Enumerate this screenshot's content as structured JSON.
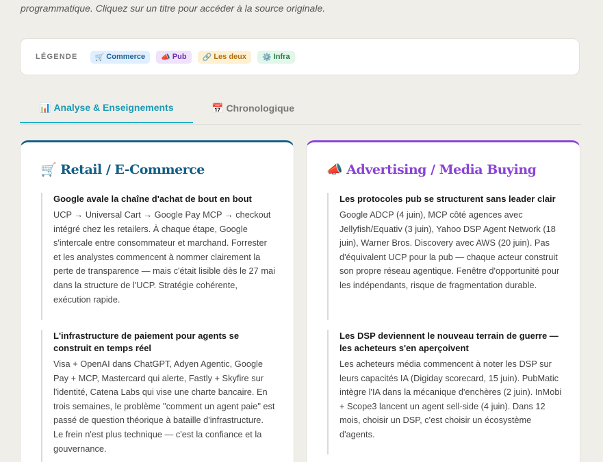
{
  "intro": {
    "text": "programmatique. Cliquez sur un titre pour accéder à la source originale."
  },
  "legend": {
    "title": "LÉGENDE",
    "badges": [
      {
        "icon": "🛒",
        "label": "Commerce",
        "color": "#1d5e92"
      },
      {
        "icon": "📣",
        "label": "Pub",
        "color": "#6b2fb3"
      },
      {
        "icon": "🔗",
        "label": "Les deux",
        "color": "#b0700e"
      },
      {
        "icon": "⚙️",
        "label": "Infra",
        "color": "#1f7a45"
      }
    ]
  },
  "tabs": [
    {
      "icon": "📊",
      "label": "Analyse & Enseignements",
      "active": true,
      "color": "#1b9bb3"
    },
    {
      "icon": "📅",
      "label": "Chronologique",
      "active": false
    }
  ],
  "columns": [
    {
      "icon": "🛒",
      "title": "Retail / E-Commerce",
      "accent": "#135f86",
      "items": [
        {
          "title": "Google avale la chaîne d'achat de bout en bout",
          "text": "UCP → Universal Cart → Google Pay MCP → checkout intégré chez les retailers. À chaque étape, Google s'intercale entre consommateur et marchand. Forrester et les analystes commencent à nommer clairement la perte de transparence — mais c'était lisible dès le 27 mai dans la structure de l'UCP. Stratégie cohérente, exécution rapide."
        },
        {
          "title": "L'infrastructure de paiement pour agents se construit en temps réel",
          "text": "Visa + OpenAI dans ChatGPT, Adyen Agentic, Google Pay + MCP, Mastercard qui alerte, Fastly + Skyfire sur l'identité, Catena Labs qui vise une charte bancaire. En trois semaines, le problème \"comment un agent paie\" est passé de question théorique à bataille d'infrastructure. Le frein n'est plus technique — c'est la confiance et la gouvernance."
        }
      ]
    },
    {
      "icon": "📣",
      "title": "Advertising / Media Buying",
      "accent": "#8a44d6",
      "items": [
        {
          "title": "Les protocoles pub se structurent sans leader clair",
          "text": "Google ADCP (4 juin), MCP côté agences avec Jellyfish/Equativ (3 juin), Yahoo DSP Agent Network (18 juin), Warner Bros. Discovery avec AWS (20 juin). Pas d'équivalent UCP pour la pub — chaque acteur construit son propre réseau agentique. Fenêtre d'opportunité pour les indépendants, risque de fragmentation durable."
        },
        {
          "title": "Les DSP deviennent le nouveau terrain de guerre — les acheteurs s'en aperçoivent",
          "text": "Les acheteurs média commencent à noter les DSP sur leurs capacités IA (Digiday scorecard, 15 juin). PubMatic intègre l'IA dans la mécanique d'enchères (2 juin). InMobi + Scope3 lancent un agent sell-side (4 juin). Dans 12 mois, choisir un DSP, c'est choisir un écosystème d'agents."
        }
      ]
    }
  ]
}
